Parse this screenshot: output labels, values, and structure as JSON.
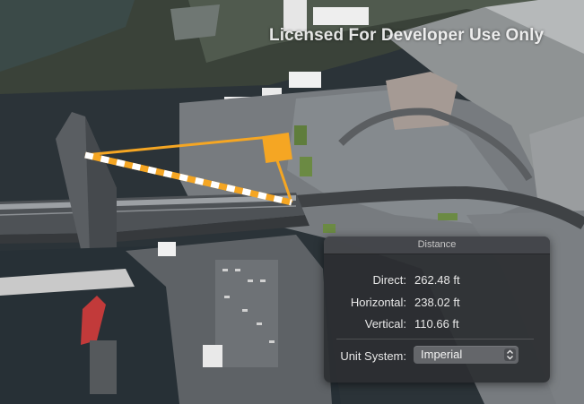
{
  "watermark": "Licensed For Developer Use Only",
  "distance_panel": {
    "title": "Distance",
    "direct_label": "Direct:",
    "direct_value": "262.48 ft",
    "horizontal_label": "Horizontal:",
    "horizontal_value": "238.02 ft",
    "vertical_label": "Vertical:",
    "vertical_value": "110.66 ft",
    "unit_system_label": "Unit System:",
    "unit_system_value": "Imperial",
    "unit_system_icon": "chevron-up-down-icon"
  },
  "colors": {
    "measure_line": "#f5a623",
    "measure_dash": "#ffffff",
    "panel_bg": "#2c2e32"
  }
}
